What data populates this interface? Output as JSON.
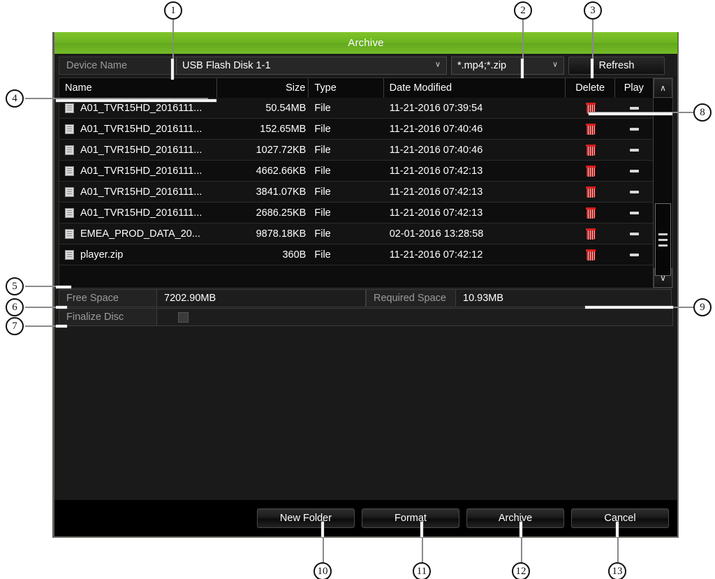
{
  "window": {
    "title": "Archive"
  },
  "toolbar": {
    "device_label": "Device Name",
    "device_value": "USB Flash Disk 1-1",
    "filter_value": "*.mp4;*.zip",
    "refresh_label": "Refresh",
    "chevron": "∨"
  },
  "table": {
    "headers": {
      "name": "Name",
      "size": "Size",
      "type": "Type",
      "date": "Date Modified",
      "delete": "Delete",
      "play": "Play"
    },
    "rows": [
      {
        "name": "A01_TVR15HD_2016111...",
        "size": "50.54MB",
        "type": "File",
        "date": "11-21-2016 07:39:54"
      },
      {
        "name": "A01_TVR15HD_2016111...",
        "size": "152.65MB",
        "type": "File",
        "date": "11-21-2016 07:40:46"
      },
      {
        "name": "A01_TVR15HD_2016111...",
        "size": "1027.72KB",
        "type": "File",
        "date": "11-21-2016 07:40:46"
      },
      {
        "name": "A01_TVR15HD_2016111...",
        "size": "4662.66KB",
        "type": "File",
        "date": "11-21-2016 07:42:13"
      },
      {
        "name": "A01_TVR15HD_2016111...",
        "size": "3841.07KB",
        "type": "File",
        "date": "11-21-2016 07:42:13"
      },
      {
        "name": "A01_TVR15HD_2016111...",
        "size": "2686.25KB",
        "type": "File",
        "date": "11-21-2016 07:42:13"
      },
      {
        "name": "EMEA_PROD_DATA_20...",
        "size": "9878.18KB",
        "type": "File",
        "date": "02-01-2016 13:28:58"
      },
      {
        "name": "player.zip",
        "size": "360B",
        "type": "File",
        "date": "11-21-2016 07:42:12"
      }
    ],
    "scroll_up": "∧",
    "scroll_down": "∨"
  },
  "info": {
    "free_space_label": "Free Space",
    "free_space_value": "7202.90MB",
    "required_space_label": "Required Space",
    "required_space_value": "10.93MB",
    "finalize_disc_label": "Finalize Disc"
  },
  "footer": {
    "new_folder": "New Folder",
    "format": "Format",
    "archive": "Archive",
    "cancel": "Cancel"
  },
  "callouts": {
    "c1": "1",
    "c2": "2",
    "c3": "3",
    "c4": "4",
    "c5": "5",
    "c6": "6",
    "c7": "7",
    "c8": "8",
    "c9": "9",
    "c10": "10",
    "c11": "11",
    "c12": "12",
    "c13": "13"
  },
  "colors": {
    "title_green": "#6cb322",
    "delete_red": "#cf1f1f",
    "window_bg": "#1a1a1a"
  }
}
